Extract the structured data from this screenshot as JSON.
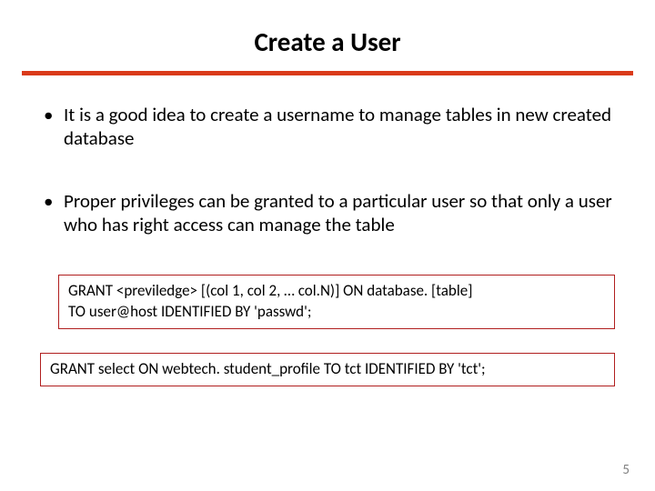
{
  "title": "Create a User",
  "bullets": [
    "It is a good idea to create a username to manage tables in new created database",
    "Proper privileges can be granted to a particular user so that only a user who has right access can manage the table"
  ],
  "codebox1_line1": "GRANT <previledge> [(col 1, col 2, … col.N)] ON database. [table]",
  "codebox1_line2": "TO user@host IDENTIFIED BY 'passwd';",
  "codebox2": "GRANT select ON webtech. student_profile TO tct IDENTIFIED BY 'tct';",
  "page_number": "5"
}
